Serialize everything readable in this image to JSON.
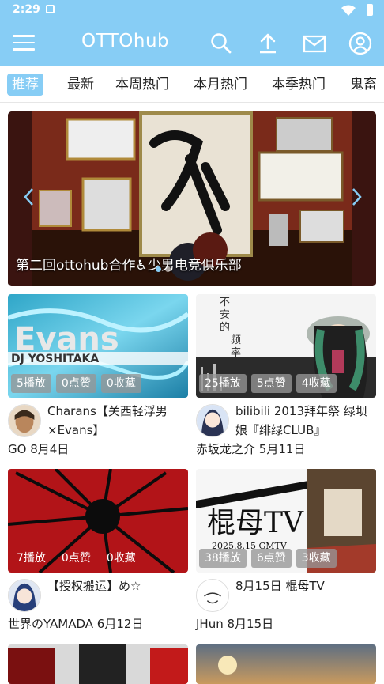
{
  "status": {
    "time": "2:29"
  },
  "appbar": {
    "title": "OTTOhub"
  },
  "tabs": [
    "推荐",
    "最新",
    "本周热门",
    "本月热门",
    "本季热门",
    "鬼畜"
  ],
  "banner": {
    "caption": "第二回ottohub合作♿少男电竞俱乐部"
  },
  "videos": [
    {
      "title": "Charans【关西轻浮男×Evans】",
      "author": "GO",
      "date": "8月4日",
      "plays": "5播放",
      "likes": "0点赞",
      "favs": "0收藏",
      "thumb_text": "Evans",
      "thumb_sub": "DJ YOSHITAKA"
    },
    {
      "title": "bilibili 2013拜年祭 绿坝娘『绯绿CLUB』",
      "author": "赤坂龙之介",
      "date": "5月11日",
      "plays": "25播放",
      "likes": "5点赞",
      "favs": "4收藏",
      "thumb_text": "不安的频率"
    },
    {
      "title": "【授权搬运】め☆",
      "author": "世界のYAMADA",
      "date": "6月12日",
      "plays": "7播放",
      "likes": "0点赞",
      "favs": "0收藏"
    },
    {
      "title": "8月15日 棍母TV",
      "author": "JHun",
      "date": "8月15日",
      "plays": "38播放",
      "likes": "6点赞",
      "favs": "3收藏",
      "thumb_text": "棍母TV",
      "thumb_sub": "2025.8.15 GMTV"
    }
  ],
  "colors": {
    "accent": "#87cdf5",
    "stat_bg": "#969696"
  }
}
